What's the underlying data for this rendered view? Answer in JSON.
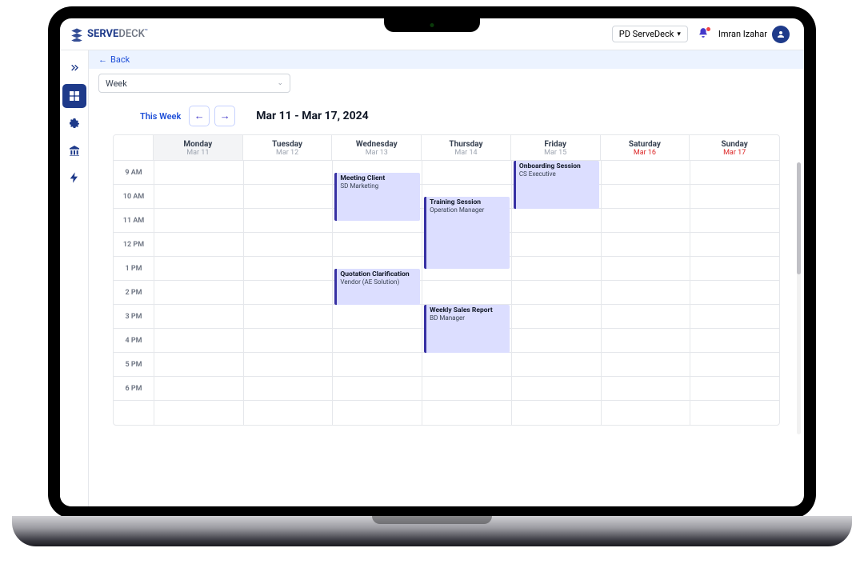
{
  "brand": {
    "name": "SERVE",
    "suffix": "DECK"
  },
  "topbar": {
    "org": "PD ServeDeck",
    "user_name": "Imran Izahar"
  },
  "sidebar": {
    "items": [
      {
        "name": "expand",
        "active": false
      },
      {
        "name": "dashboard",
        "active": true
      },
      {
        "name": "settings",
        "active": false
      },
      {
        "name": "building",
        "active": false
      },
      {
        "name": "bolt",
        "active": false
      }
    ]
  },
  "back_label": "Back",
  "view_select": "Week",
  "cal": {
    "this_week": "This Week",
    "range": "Mar 11 - Mar 17, 2024",
    "days": [
      {
        "name": "Monday",
        "date": "Mar 11",
        "today": true,
        "weekend": false
      },
      {
        "name": "Tuesday",
        "date": "Mar 12",
        "today": false,
        "weekend": false
      },
      {
        "name": "Wednesday",
        "date": "Mar 13",
        "today": false,
        "weekend": false
      },
      {
        "name": "Thursday",
        "date": "Mar 14",
        "today": false,
        "weekend": false
      },
      {
        "name": "Friday",
        "date": "Mar 15",
        "today": false,
        "weekend": false
      },
      {
        "name": "Saturday",
        "date": "Mar 16",
        "today": false,
        "weekend": true
      },
      {
        "name": "Sunday",
        "date": "Mar 17",
        "today": false,
        "weekend": true
      }
    ],
    "hours": [
      "9 AM",
      "10 AM",
      "11 AM",
      "12 PM",
      "1 PM",
      "2 PM",
      "3 PM",
      "4 PM",
      "5 PM",
      "6 PM"
    ],
    "events": [
      {
        "day": 2,
        "start": 9,
        "end": 11,
        "title": "Meeting Client",
        "sub": "SD Marketing"
      },
      {
        "day": 2,
        "start": 13,
        "end": 14.5,
        "title": "Quotation Clarification",
        "sub": "Vendor (AE Solution)"
      },
      {
        "day": 3,
        "start": 10,
        "end": 13,
        "title": "Training Session",
        "sub": "Operation Manager"
      },
      {
        "day": 3,
        "start": 14.5,
        "end": 16.5,
        "title": "Weekly Sales Report",
        "sub": "BD Manager"
      },
      {
        "day": 4,
        "start": 8.5,
        "end": 10.5,
        "title": "Onboarding Session",
        "sub": "CS Executive"
      }
    ]
  },
  "colors": {
    "accent": "#1e3a8a",
    "event_bg": "#dcdeff",
    "event_border": "#3730a3"
  }
}
